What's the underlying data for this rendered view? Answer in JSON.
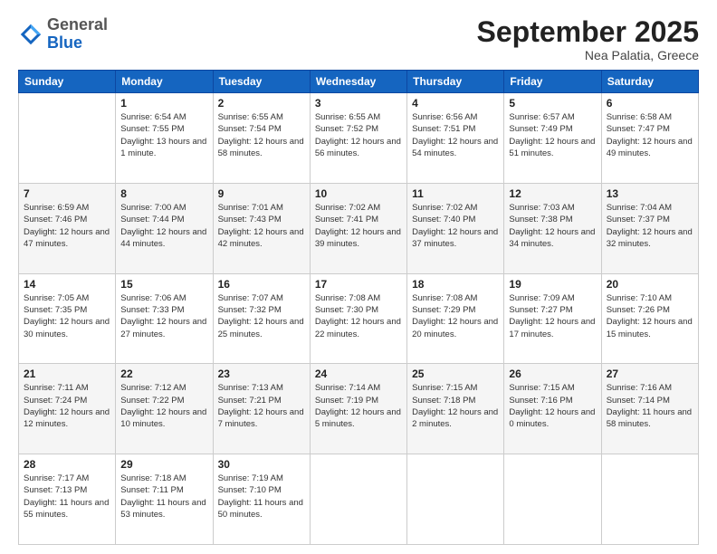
{
  "logo": {
    "general": "General",
    "blue": "Blue"
  },
  "header": {
    "month": "September 2025",
    "location": "Nea Palatia, Greece"
  },
  "weekdays": [
    "Sunday",
    "Monday",
    "Tuesday",
    "Wednesday",
    "Thursday",
    "Friday",
    "Saturday"
  ],
  "weeks": [
    [
      {
        "day": "",
        "sunrise": "",
        "sunset": "",
        "daylight": ""
      },
      {
        "day": "1",
        "sunrise": "Sunrise: 6:54 AM",
        "sunset": "Sunset: 7:55 PM",
        "daylight": "Daylight: 13 hours and 1 minute."
      },
      {
        "day": "2",
        "sunrise": "Sunrise: 6:55 AM",
        "sunset": "Sunset: 7:54 PM",
        "daylight": "Daylight: 12 hours and 58 minutes."
      },
      {
        "day": "3",
        "sunrise": "Sunrise: 6:55 AM",
        "sunset": "Sunset: 7:52 PM",
        "daylight": "Daylight: 12 hours and 56 minutes."
      },
      {
        "day": "4",
        "sunrise": "Sunrise: 6:56 AM",
        "sunset": "Sunset: 7:51 PM",
        "daylight": "Daylight: 12 hours and 54 minutes."
      },
      {
        "day": "5",
        "sunrise": "Sunrise: 6:57 AM",
        "sunset": "Sunset: 7:49 PM",
        "daylight": "Daylight: 12 hours and 51 minutes."
      },
      {
        "day": "6",
        "sunrise": "Sunrise: 6:58 AM",
        "sunset": "Sunset: 7:47 PM",
        "daylight": "Daylight: 12 hours and 49 minutes."
      }
    ],
    [
      {
        "day": "7",
        "sunrise": "Sunrise: 6:59 AM",
        "sunset": "Sunset: 7:46 PM",
        "daylight": "Daylight: 12 hours and 47 minutes."
      },
      {
        "day": "8",
        "sunrise": "Sunrise: 7:00 AM",
        "sunset": "Sunset: 7:44 PM",
        "daylight": "Daylight: 12 hours and 44 minutes."
      },
      {
        "day": "9",
        "sunrise": "Sunrise: 7:01 AM",
        "sunset": "Sunset: 7:43 PM",
        "daylight": "Daylight: 12 hours and 42 minutes."
      },
      {
        "day": "10",
        "sunrise": "Sunrise: 7:02 AM",
        "sunset": "Sunset: 7:41 PM",
        "daylight": "Daylight: 12 hours and 39 minutes."
      },
      {
        "day": "11",
        "sunrise": "Sunrise: 7:02 AM",
        "sunset": "Sunset: 7:40 PM",
        "daylight": "Daylight: 12 hours and 37 minutes."
      },
      {
        "day": "12",
        "sunrise": "Sunrise: 7:03 AM",
        "sunset": "Sunset: 7:38 PM",
        "daylight": "Daylight: 12 hours and 34 minutes."
      },
      {
        "day": "13",
        "sunrise": "Sunrise: 7:04 AM",
        "sunset": "Sunset: 7:37 PM",
        "daylight": "Daylight: 12 hours and 32 minutes."
      }
    ],
    [
      {
        "day": "14",
        "sunrise": "Sunrise: 7:05 AM",
        "sunset": "Sunset: 7:35 PM",
        "daylight": "Daylight: 12 hours and 30 minutes."
      },
      {
        "day": "15",
        "sunrise": "Sunrise: 7:06 AM",
        "sunset": "Sunset: 7:33 PM",
        "daylight": "Daylight: 12 hours and 27 minutes."
      },
      {
        "day": "16",
        "sunrise": "Sunrise: 7:07 AM",
        "sunset": "Sunset: 7:32 PM",
        "daylight": "Daylight: 12 hours and 25 minutes."
      },
      {
        "day": "17",
        "sunrise": "Sunrise: 7:08 AM",
        "sunset": "Sunset: 7:30 PM",
        "daylight": "Daylight: 12 hours and 22 minutes."
      },
      {
        "day": "18",
        "sunrise": "Sunrise: 7:08 AM",
        "sunset": "Sunset: 7:29 PM",
        "daylight": "Daylight: 12 hours and 20 minutes."
      },
      {
        "day": "19",
        "sunrise": "Sunrise: 7:09 AM",
        "sunset": "Sunset: 7:27 PM",
        "daylight": "Daylight: 12 hours and 17 minutes."
      },
      {
        "day": "20",
        "sunrise": "Sunrise: 7:10 AM",
        "sunset": "Sunset: 7:26 PM",
        "daylight": "Daylight: 12 hours and 15 minutes."
      }
    ],
    [
      {
        "day": "21",
        "sunrise": "Sunrise: 7:11 AM",
        "sunset": "Sunset: 7:24 PM",
        "daylight": "Daylight: 12 hours and 12 minutes."
      },
      {
        "day": "22",
        "sunrise": "Sunrise: 7:12 AM",
        "sunset": "Sunset: 7:22 PM",
        "daylight": "Daylight: 12 hours and 10 minutes."
      },
      {
        "day": "23",
        "sunrise": "Sunrise: 7:13 AM",
        "sunset": "Sunset: 7:21 PM",
        "daylight": "Daylight: 12 hours and 7 minutes."
      },
      {
        "day": "24",
        "sunrise": "Sunrise: 7:14 AM",
        "sunset": "Sunset: 7:19 PM",
        "daylight": "Daylight: 12 hours and 5 minutes."
      },
      {
        "day": "25",
        "sunrise": "Sunrise: 7:15 AM",
        "sunset": "Sunset: 7:18 PM",
        "daylight": "Daylight: 12 hours and 2 minutes."
      },
      {
        "day": "26",
        "sunrise": "Sunrise: 7:15 AM",
        "sunset": "Sunset: 7:16 PM",
        "daylight": "Daylight: 12 hours and 0 minutes."
      },
      {
        "day": "27",
        "sunrise": "Sunrise: 7:16 AM",
        "sunset": "Sunset: 7:14 PM",
        "daylight": "Daylight: 11 hours and 58 minutes."
      }
    ],
    [
      {
        "day": "28",
        "sunrise": "Sunrise: 7:17 AM",
        "sunset": "Sunset: 7:13 PM",
        "daylight": "Daylight: 11 hours and 55 minutes."
      },
      {
        "day": "29",
        "sunrise": "Sunrise: 7:18 AM",
        "sunset": "Sunset: 7:11 PM",
        "daylight": "Daylight: 11 hours and 53 minutes."
      },
      {
        "day": "30",
        "sunrise": "Sunrise: 7:19 AM",
        "sunset": "Sunset: 7:10 PM",
        "daylight": "Daylight: 11 hours and 50 minutes."
      },
      {
        "day": "",
        "sunrise": "",
        "sunset": "",
        "daylight": ""
      },
      {
        "day": "",
        "sunrise": "",
        "sunset": "",
        "daylight": ""
      },
      {
        "day": "",
        "sunrise": "",
        "sunset": "",
        "daylight": ""
      },
      {
        "day": "",
        "sunrise": "",
        "sunset": "",
        "daylight": ""
      }
    ]
  ]
}
